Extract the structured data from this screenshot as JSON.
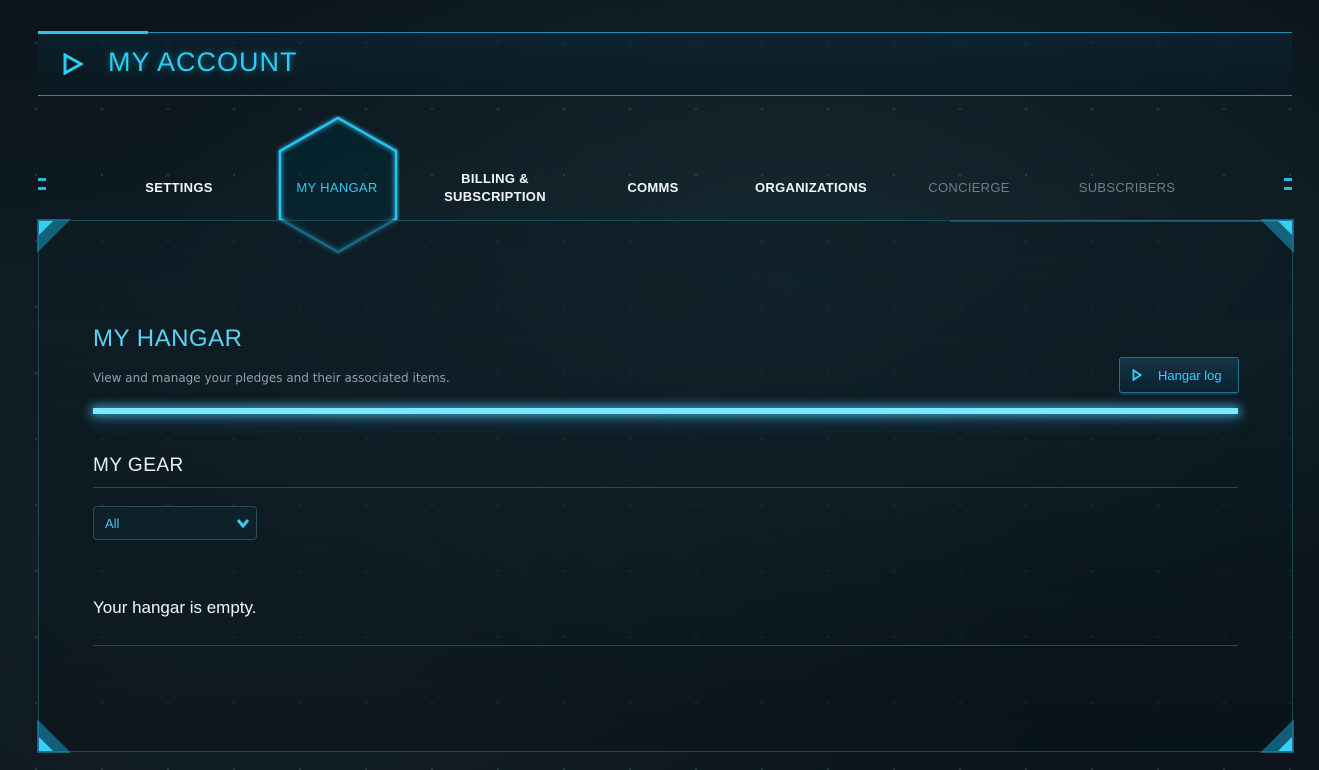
{
  "header": {
    "title": "MY ACCOUNT"
  },
  "tabs": [
    {
      "label": "SETTINGS",
      "state": "normal"
    },
    {
      "label": "MY HANGAR",
      "state": "active"
    },
    {
      "label": "BILLING &\nSUBSCRIPTION",
      "state": "normal"
    },
    {
      "label": "COMMS",
      "state": "normal"
    },
    {
      "label": "ORGANIZATIONS",
      "state": "normal"
    },
    {
      "label": "CONCIERGE",
      "state": "disabled"
    },
    {
      "label": "SUBSCRIBERS",
      "state": "disabled"
    }
  ],
  "hangar": {
    "title": "MY HANGAR",
    "subtitle": "View and manage your pledges and their associated items.",
    "log_button": "Hangar log"
  },
  "gear": {
    "title": "MY GEAR",
    "filter": {
      "selected": "All"
    },
    "empty_message": "Your hangar is empty."
  },
  "icons": {
    "header": "play-icon",
    "log_button": "play-icon",
    "filter": "chevron-down-icon"
  },
  "colors": {
    "accent": "#2ccdf5",
    "glow_bar": "#7fe6ff",
    "background": "#0a1419",
    "muted_tab": "#6f7e86"
  }
}
